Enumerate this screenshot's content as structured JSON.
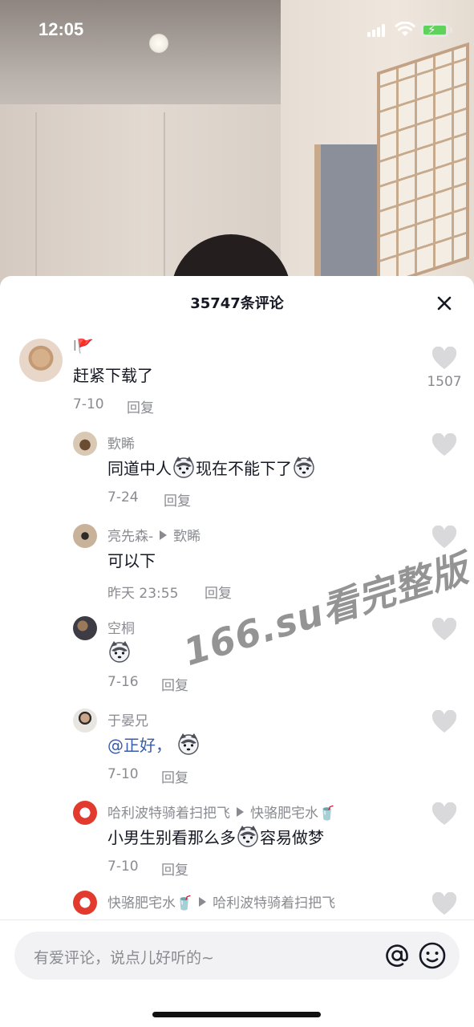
{
  "status_bar": {
    "time": "12:05"
  },
  "sheet": {
    "title": "35747条评论",
    "close_icon": "close-icon"
  },
  "comments": [
    {
      "user": "l🚩",
      "text": "赶紧下载了",
      "date": "7-10",
      "reply": "回复",
      "likes": "1507"
    },
    {
      "user": "歅睎",
      "text_before": "同道中人",
      "text_after": "现在不能下了",
      "date": "7-24",
      "reply": "回复"
    },
    {
      "user": "亮先森-",
      "reply_to": "歅睎",
      "text": "可以下",
      "date": "昨天 23:55",
      "reply": "回复"
    },
    {
      "user": "空桐",
      "text": "",
      "date": "7-16",
      "reply": "回复"
    },
    {
      "user": "于晏兄",
      "mention": "@正好，",
      "date": "7-10",
      "reply": "回复"
    },
    {
      "user": "哈利波特骑着扫把飞",
      "reply_to": "快骆肥宅水🥤",
      "text_before": "小男生别看那么多",
      "text_after": "容易做梦",
      "date": "7-10",
      "reply": "回复"
    },
    {
      "user": "快骆肥宅水🥤",
      "reply_to": "哈利波特骑着扫把飞"
    }
  ],
  "watermark": "166.su看完整版",
  "input": {
    "placeholder": "有爱评论，说点儿好听的~"
  },
  "icons": {
    "like": "heart-icon",
    "mention": "at-icon",
    "emoji": "smiley-icon"
  },
  "colors": {
    "mention": "#3a5cad",
    "meta": "#8a8b91",
    "text": "#161823"
  }
}
